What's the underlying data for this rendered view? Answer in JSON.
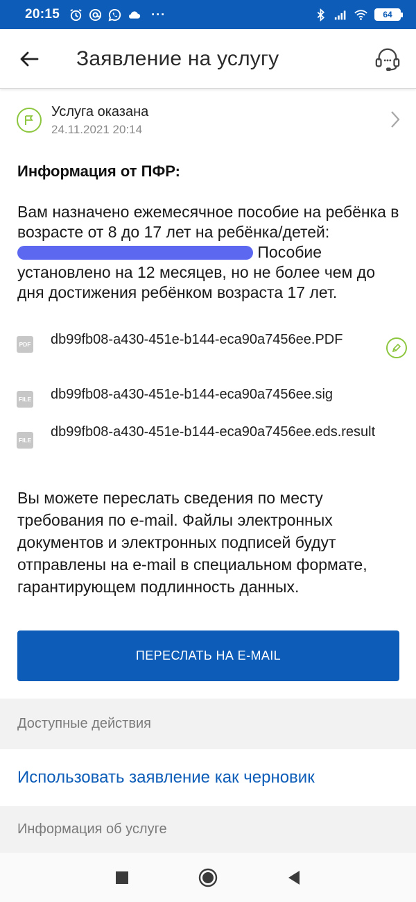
{
  "status_bar": {
    "time": "20:15",
    "dots": "···",
    "battery": "64"
  },
  "app_bar": {
    "title": "Заявление на услугу"
  },
  "status": {
    "title": "Услуга оказана",
    "date": "24.11.2021 20:14"
  },
  "info": {
    "heading": "Информация от ПФР:",
    "text_before": "Вам назначено ежемесячное пособие на ребёнка в возрасте от 8 до 17 лет на ребёнка/детей: ",
    "text_after": " Пособие установлено на 12 месяцев, но не более чем до дня достижения ребёнком возраста 17 лет."
  },
  "files": [
    {
      "icon_label": "PDF",
      "name": "db99fb08-a430-451e-b144-eca90a7456ee.PDF"
    },
    {
      "icon_label": "FILE",
      "name": "db99fb08-a430-451e-b144-eca90a7456ee.sig"
    },
    {
      "icon_label": "FILE",
      "name": "db99fb08-a430-451e-b144-eca90a7456ee.eds.result"
    }
  ],
  "email_info": "Вы можете переслать сведения по месту требования по e-mail. Файлы электронных документов и электронных подписей будут отправлены на e-mail в специальном формате, гарантирующем подлинность данных.",
  "email_button": "ПЕРЕСЛАТЬ НА E-MAIL",
  "sections": {
    "actions": "Доступные действия",
    "draft_link": "Использовать заявление как черновик",
    "service_info": "Информация об услуге"
  },
  "colors": {
    "brand_blue": "#0d5db8",
    "success_green": "#8dc63f",
    "section_gray": "#f2f2f2"
  },
  "icons": {
    "status_bar_left": [
      "alarm-icon",
      "at-icon",
      "whatsapp-icon",
      "cloud-icon"
    ],
    "status_bar_right": [
      "bluetooth-icon",
      "signal-icon",
      "wifi-icon",
      "battery-icon"
    ],
    "app_bar": [
      "back-arrow-icon",
      "headset-support-icon"
    ],
    "status": "flag-icon",
    "file_sign": "pen-sign-icon",
    "navigation": [
      "square-recents-icon",
      "circle-home-icon",
      "triangle-back-icon"
    ]
  }
}
